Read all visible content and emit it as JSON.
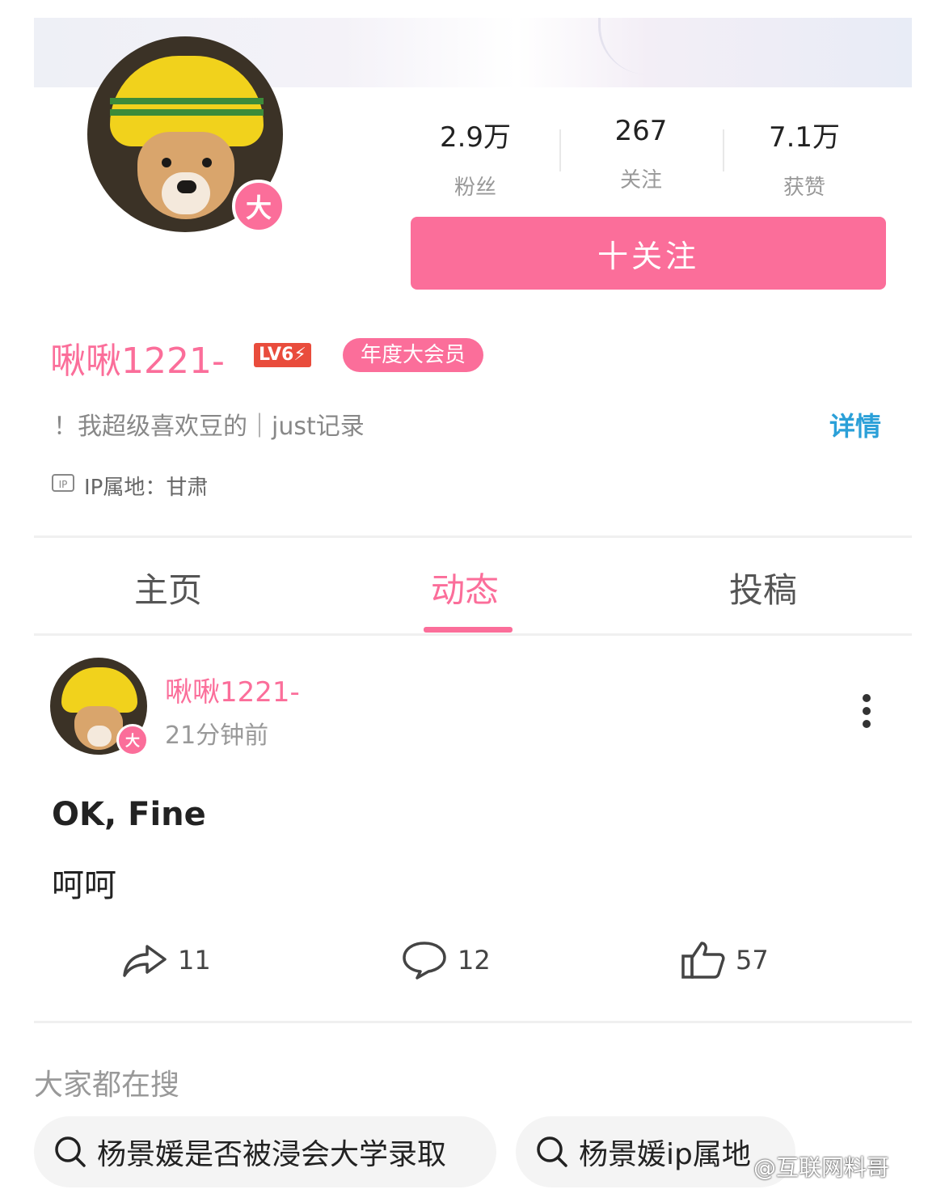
{
  "profile": {
    "stats": [
      {
        "value": "2.9万",
        "label": "粉丝"
      },
      {
        "value": "267",
        "label": "关注"
      },
      {
        "value": "7.1万",
        "label": "获赞"
      }
    ],
    "follow_label": "十关注",
    "badge": "大",
    "username": "啾啾1221-",
    "level": "LV6⚡",
    "vip_label": "年度大会员",
    "bio": "！我超级喜欢豆的｜just记录",
    "detail_label": "详情",
    "ip_icon": "IP",
    "ip_location": "IP属地：甘肃"
  },
  "tabs": [
    "主页",
    "动态",
    "投稿"
  ],
  "active_tab": "动态",
  "post": {
    "author": "啾啾1221-",
    "time": "21分钟前",
    "badge": "大",
    "lines": [
      "OK, Fine",
      "呵呵"
    ],
    "shares": "11",
    "comments": "12",
    "likes": "57"
  },
  "hot_search": {
    "title": "大家都在搜",
    "items": [
      "杨景媛是否被浸会大学录取",
      "杨景媛ip属地"
    ]
  },
  "watermark": "@互联网料哥",
  "colors": {
    "accent": "#fb6e9a",
    "link": "#2ba0d8"
  }
}
